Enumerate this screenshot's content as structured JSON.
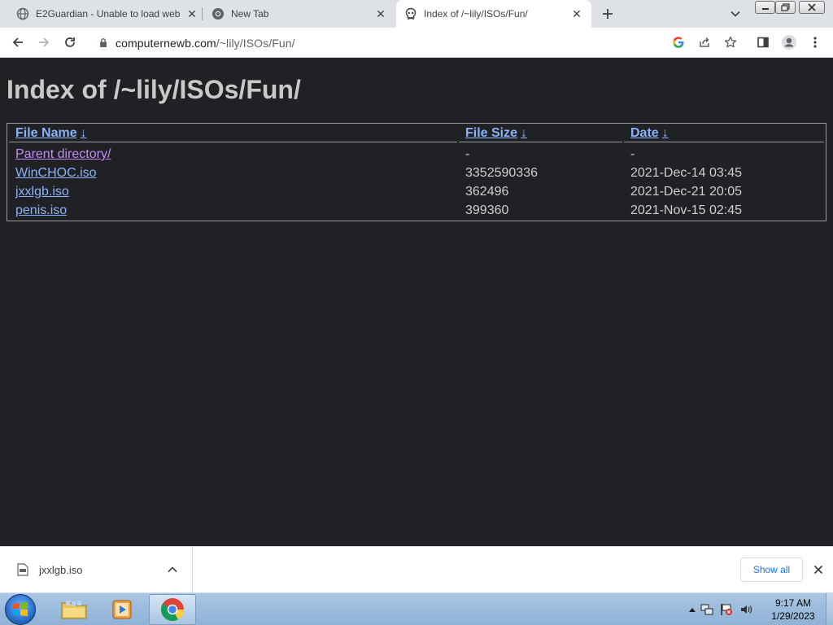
{
  "tabs": [
    {
      "title": "E2Guardian - Unable to load web",
      "icon": "globe-icon",
      "active": false
    },
    {
      "title": "New Tab",
      "icon": "chrome-icon",
      "active": false
    },
    {
      "title": "Index of /~lily/ISOs/Fun/",
      "icon": "skull-icon",
      "active": true
    }
  ],
  "toolbar": {
    "url_host": "computernewb.com",
    "url_path": "/~lily/ISOs/Fun/"
  },
  "page": {
    "heading": "Index of /~lily/ISOs/Fun/",
    "columns": [
      {
        "label": "File Name",
        "arrow": "↓"
      },
      {
        "label": "File Size",
        "arrow": "↓"
      },
      {
        "label": "Date",
        "arrow": "↓"
      }
    ],
    "rows": [
      {
        "name": "Parent directory/",
        "size": "-",
        "date": "-",
        "visited": true
      },
      {
        "name": "WinCHOC.iso",
        "size": "3352590336",
        "date": "2021-Dec-14 03:45",
        "visited": false
      },
      {
        "name": "jxxlgb.iso",
        "size": "362496",
        "date": "2021-Dec-21 20:05",
        "visited": false
      },
      {
        "name": "penis.iso",
        "size": "399360",
        "date": "2021-Nov-15 02:45",
        "visited": false
      }
    ]
  },
  "downloads": {
    "filename": "jxxlgb.iso",
    "show_all_label": "Show all"
  },
  "taskbar": {
    "time": "9:17 AM",
    "date": "1/29/2023"
  },
  "colors": {
    "page_bg": "#202124",
    "link": "#8ab4f8",
    "visited_link": "#c58af9",
    "accent": "#1a73e8"
  }
}
